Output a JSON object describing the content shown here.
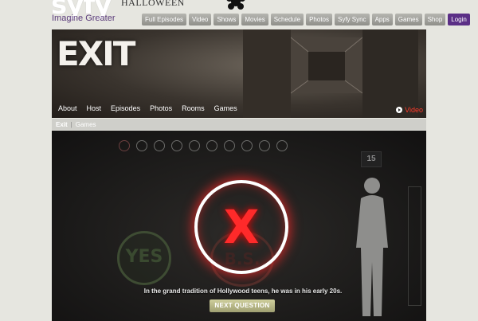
{
  "header": {
    "logo": "syfy",
    "tagline": "Imagine Greater",
    "promo": "HALLOWEEN",
    "nav": [
      "Full Episodes",
      "Video",
      "Shows",
      "Movies",
      "Schedule",
      "Photos",
      "Syfy Sync",
      "Apps",
      "Games",
      "Shop"
    ],
    "login": "Login"
  },
  "hero": {
    "title": "EXIT",
    "subnav": [
      "About",
      "Host",
      "Episodes",
      "Photos",
      "Rooms",
      "Games"
    ],
    "video_label": "Video"
  },
  "breadcrumb": {
    "current": "Exit",
    "separator": "|",
    "section": "Games"
  },
  "game": {
    "progress": {
      "total": 10,
      "marked": 1
    },
    "elevator_floor": "15",
    "yes_label": "YES",
    "bs_label": "B.S.",
    "verdict": "X",
    "message": "In the grand tradition of Hollywood teens, he was in his early 20s.",
    "next_button": "NEXT QUESTION"
  },
  "colors": {
    "accent": "#5b2f86",
    "verdict": "#ff2a2a",
    "video": "#ff3a2a"
  }
}
